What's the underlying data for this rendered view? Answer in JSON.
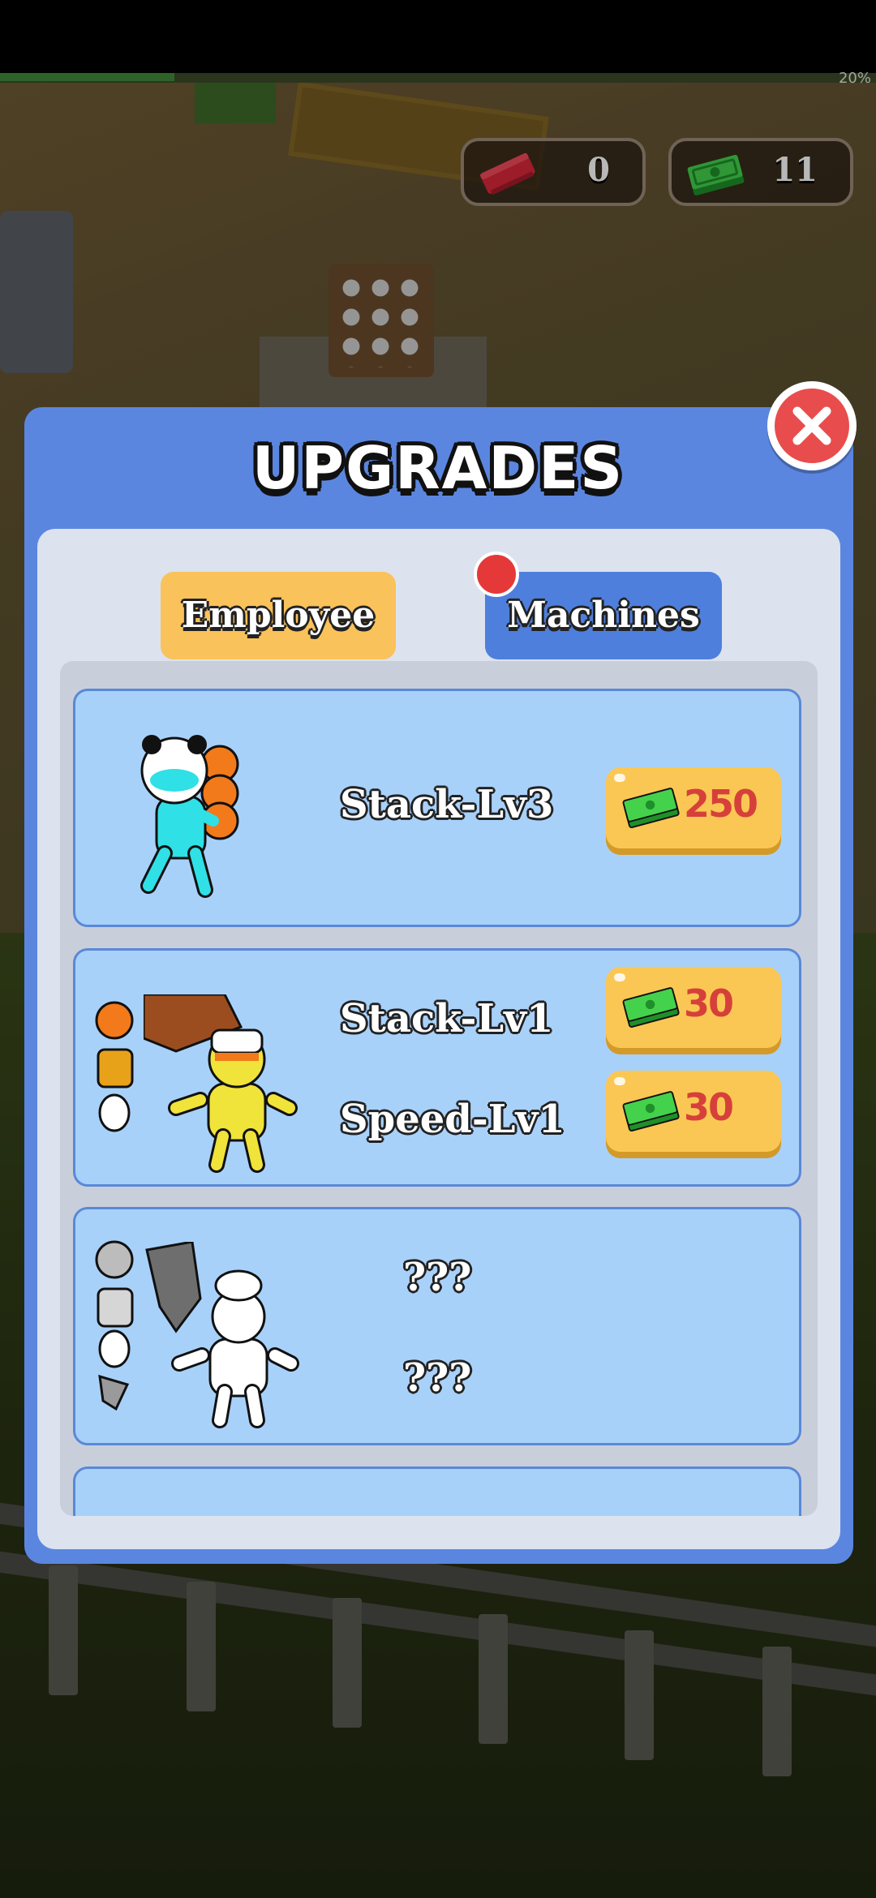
{
  "status": {
    "battery_percent": "20%",
    "progress": 0.2
  },
  "hud": {
    "red_ticket_count": "0",
    "cash_count": "11"
  },
  "panel": {
    "title": "UPGRADES",
    "tabs": [
      {
        "label": "Employee",
        "color": "#fac25a"
      },
      {
        "label": "Machines",
        "color": "#4f7fdc",
        "has_notification": true
      }
    ]
  },
  "upgrades": [
    {
      "character": "panda-worker",
      "rows": [
        {
          "label": "Stack-Lv3",
          "price": "250"
        }
      ]
    },
    {
      "character": "chef-worker",
      "rows": [
        {
          "label": "Stack-Lv1",
          "price": "30"
        },
        {
          "label": "Speed-Lv1",
          "price": "30"
        }
      ]
    },
    {
      "character": "locked-worker",
      "rows": [
        {
          "label": "???"
        },
        {
          "label": "???"
        }
      ]
    }
  ],
  "colors": {
    "panel": "#5b86e0",
    "card": "#a8d1fa",
    "buy_button": "#fbc754",
    "price_text": "#d6403a",
    "close": "#e84c4c"
  }
}
